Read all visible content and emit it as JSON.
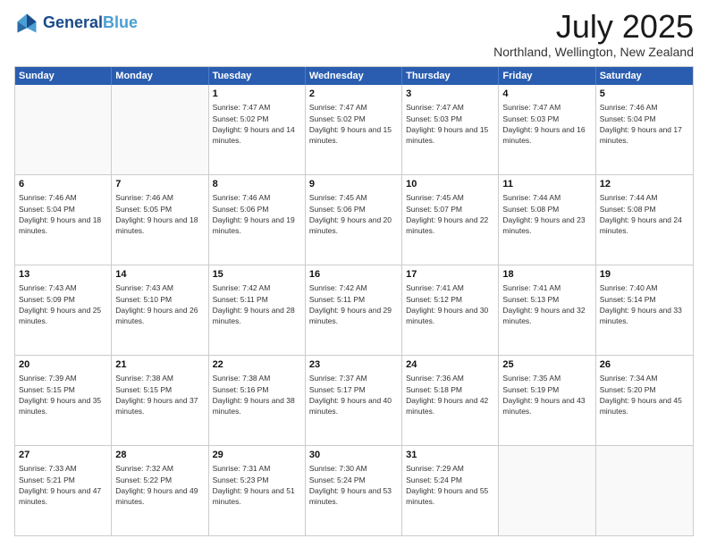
{
  "logo": {
    "line1": "General",
    "line2": "Blue"
  },
  "title": "July 2025",
  "location": "Northland, Wellington, New Zealand",
  "days": [
    "Sunday",
    "Monday",
    "Tuesday",
    "Wednesday",
    "Thursday",
    "Friday",
    "Saturday"
  ],
  "weeks": [
    [
      {
        "day": "",
        "empty": true
      },
      {
        "day": "",
        "empty": true
      },
      {
        "day": "1",
        "sunrise": "7:47 AM",
        "sunset": "5:02 PM",
        "daylight": "9 hours and 14 minutes."
      },
      {
        "day": "2",
        "sunrise": "7:47 AM",
        "sunset": "5:02 PM",
        "daylight": "9 hours and 15 minutes."
      },
      {
        "day": "3",
        "sunrise": "7:47 AM",
        "sunset": "5:03 PM",
        "daylight": "9 hours and 15 minutes."
      },
      {
        "day": "4",
        "sunrise": "7:47 AM",
        "sunset": "5:03 PM",
        "daylight": "9 hours and 16 minutes."
      },
      {
        "day": "5",
        "sunrise": "7:46 AM",
        "sunset": "5:04 PM",
        "daylight": "9 hours and 17 minutes."
      }
    ],
    [
      {
        "day": "6",
        "sunrise": "7:46 AM",
        "sunset": "5:04 PM",
        "daylight": "9 hours and 18 minutes."
      },
      {
        "day": "7",
        "sunrise": "7:46 AM",
        "sunset": "5:05 PM",
        "daylight": "9 hours and 18 minutes."
      },
      {
        "day": "8",
        "sunrise": "7:46 AM",
        "sunset": "5:06 PM",
        "daylight": "9 hours and 19 minutes."
      },
      {
        "day": "9",
        "sunrise": "7:45 AM",
        "sunset": "5:06 PM",
        "daylight": "9 hours and 20 minutes."
      },
      {
        "day": "10",
        "sunrise": "7:45 AM",
        "sunset": "5:07 PM",
        "daylight": "9 hours and 22 minutes."
      },
      {
        "day": "11",
        "sunrise": "7:44 AM",
        "sunset": "5:08 PM",
        "daylight": "9 hours and 23 minutes."
      },
      {
        "day": "12",
        "sunrise": "7:44 AM",
        "sunset": "5:08 PM",
        "daylight": "9 hours and 24 minutes."
      }
    ],
    [
      {
        "day": "13",
        "sunrise": "7:43 AM",
        "sunset": "5:09 PM",
        "daylight": "9 hours and 25 minutes."
      },
      {
        "day": "14",
        "sunrise": "7:43 AM",
        "sunset": "5:10 PM",
        "daylight": "9 hours and 26 minutes."
      },
      {
        "day": "15",
        "sunrise": "7:42 AM",
        "sunset": "5:11 PM",
        "daylight": "9 hours and 28 minutes."
      },
      {
        "day": "16",
        "sunrise": "7:42 AM",
        "sunset": "5:11 PM",
        "daylight": "9 hours and 29 minutes."
      },
      {
        "day": "17",
        "sunrise": "7:41 AM",
        "sunset": "5:12 PM",
        "daylight": "9 hours and 30 minutes."
      },
      {
        "day": "18",
        "sunrise": "7:41 AM",
        "sunset": "5:13 PM",
        "daylight": "9 hours and 32 minutes."
      },
      {
        "day": "19",
        "sunrise": "7:40 AM",
        "sunset": "5:14 PM",
        "daylight": "9 hours and 33 minutes."
      }
    ],
    [
      {
        "day": "20",
        "sunrise": "7:39 AM",
        "sunset": "5:15 PM",
        "daylight": "9 hours and 35 minutes."
      },
      {
        "day": "21",
        "sunrise": "7:38 AM",
        "sunset": "5:15 PM",
        "daylight": "9 hours and 37 minutes."
      },
      {
        "day": "22",
        "sunrise": "7:38 AM",
        "sunset": "5:16 PM",
        "daylight": "9 hours and 38 minutes."
      },
      {
        "day": "23",
        "sunrise": "7:37 AM",
        "sunset": "5:17 PM",
        "daylight": "9 hours and 40 minutes."
      },
      {
        "day": "24",
        "sunrise": "7:36 AM",
        "sunset": "5:18 PM",
        "daylight": "9 hours and 42 minutes."
      },
      {
        "day": "25",
        "sunrise": "7:35 AM",
        "sunset": "5:19 PM",
        "daylight": "9 hours and 43 minutes."
      },
      {
        "day": "26",
        "sunrise": "7:34 AM",
        "sunset": "5:20 PM",
        "daylight": "9 hours and 45 minutes."
      }
    ],
    [
      {
        "day": "27",
        "sunrise": "7:33 AM",
        "sunset": "5:21 PM",
        "daylight": "9 hours and 47 minutes."
      },
      {
        "day": "28",
        "sunrise": "7:32 AM",
        "sunset": "5:22 PM",
        "daylight": "9 hours and 49 minutes."
      },
      {
        "day": "29",
        "sunrise": "7:31 AM",
        "sunset": "5:23 PM",
        "daylight": "9 hours and 51 minutes."
      },
      {
        "day": "30",
        "sunrise": "7:30 AM",
        "sunset": "5:24 PM",
        "daylight": "9 hours and 53 minutes."
      },
      {
        "day": "31",
        "sunrise": "7:29 AM",
        "sunset": "5:24 PM",
        "daylight": "9 hours and 55 minutes."
      },
      {
        "day": "",
        "empty": true
      },
      {
        "day": "",
        "empty": true
      }
    ]
  ]
}
